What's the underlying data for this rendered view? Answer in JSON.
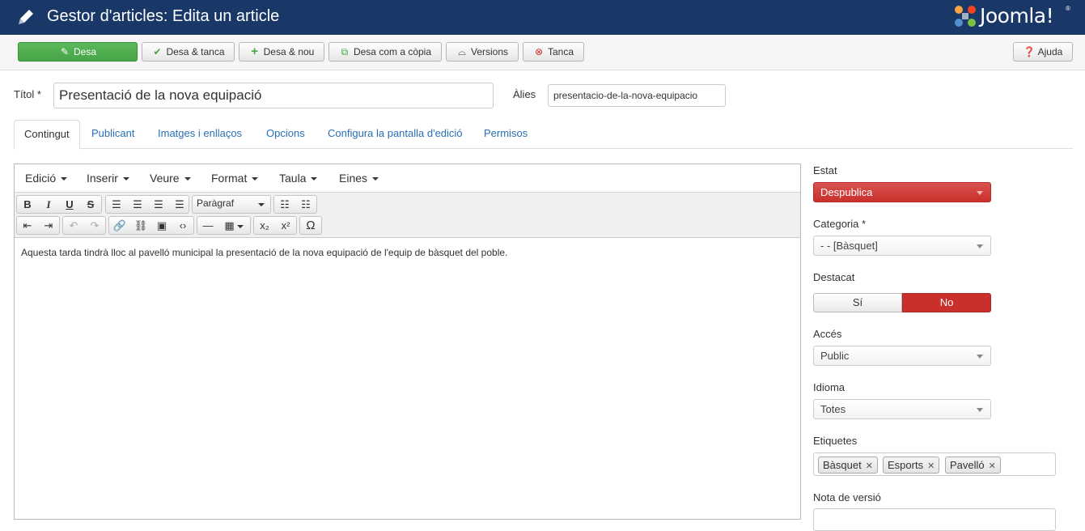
{
  "header": {
    "title": "Gestor d'articles: Edita un article",
    "logo_text": "Joomla!",
    "logo_trademark": "®",
    "background": "#1a3867"
  },
  "toolbar": {
    "save": "Desa",
    "save_close": "Desa & tanca",
    "save_new": "Desa & nou",
    "save_copy": "Desa com a còpia",
    "versions": "Versions",
    "close": "Tanca",
    "help": "Ajuda"
  },
  "form": {
    "title_label": "Títol *",
    "title_value": "Presentació de la nova equipació",
    "alias_label": "Àlies",
    "alias_value": "presentacio-de-la-nova-equipacio"
  },
  "tabs": [
    {
      "label": "Contingut"
    },
    {
      "label": "Publicant"
    },
    {
      "label": "Imatges i enllaços"
    },
    {
      "label": "Opcions"
    },
    {
      "label": "Configura la pantalla d'edició"
    },
    {
      "label": "Permisos"
    }
  ],
  "editor": {
    "menus": [
      "Edició",
      "Inserir",
      "Veure",
      "Format",
      "Taula",
      "Eines"
    ],
    "format_select": "Paràgraf",
    "body_text": "Aquesta tarda tindrà lloc al pavelló municipal la presentació de la nova equipació de l'equip de bàsquet del poble."
  },
  "sidebar": {
    "status_label": "Estat",
    "status_value": "Despublica",
    "category_label": "Categoria *",
    "category_value": "- - [Bàsquet]",
    "featured_label": "Destacat",
    "featured_yes": "Sí",
    "featured_no": "No",
    "access_label": "Accés",
    "access_value": "Public",
    "language_label": "Idioma",
    "language_value": "Totes",
    "tags_label": "Etiquetes",
    "tags": [
      "Bàsquet",
      "Esports",
      "Pavelló"
    ],
    "tag_remove": "✕",
    "version_note_label": "Nota de versió"
  },
  "colors": {
    "accent_green": "#46a546",
    "danger_red": "#c9302c",
    "link_blue": "#2a6fb5"
  }
}
